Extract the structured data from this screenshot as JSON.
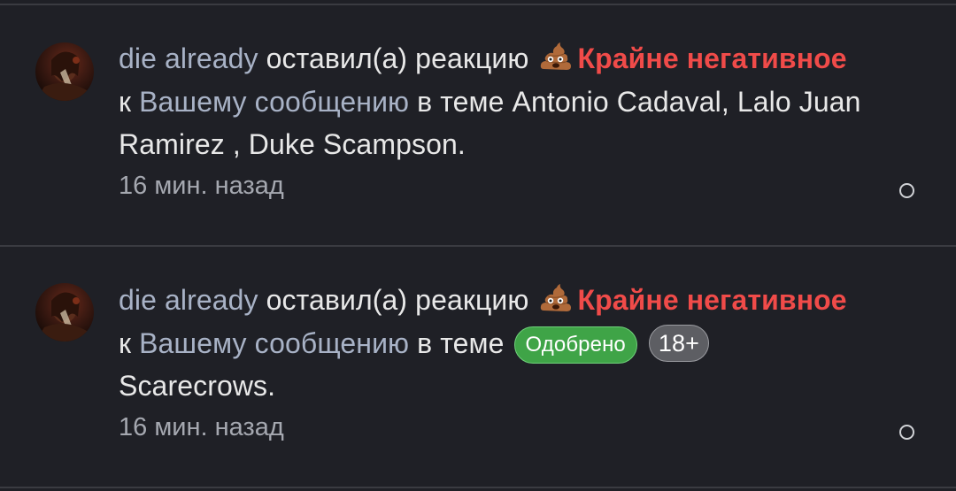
{
  "notifications": [
    {
      "username": "die already",
      "action": " оставил(а) реакцию ",
      "reaction_icon": "pile-of-poo-emoji",
      "reaction_name": "Крайне негативное",
      "line2_prefix": "к ",
      "your_message_link": "Вашему сообщению",
      "in_topic": " в теме ",
      "thread_title": "Antonio Cadaval, Lalo Juan Ramirez , Duke Scampson.",
      "time": "16 мин. назад"
    },
    {
      "username": "die already",
      "action": " оставил(а) реакцию ",
      "reaction_icon": "pile-of-poo-emoji",
      "reaction_name": "Крайне негативное",
      "line2_prefix": "к ",
      "your_message_link": "Вашему сообщению",
      "in_topic": " в теме ",
      "prefix_badges": [
        "Одобрено",
        "18+"
      ],
      "thread_title": "Scarecrows.",
      "time": "16 мин. назад"
    }
  ],
  "colors": {
    "background": "#1f2026",
    "reaction_text": "#f04b49",
    "badge_approved": "#3fa447",
    "badge_age": "#5d5e63"
  }
}
